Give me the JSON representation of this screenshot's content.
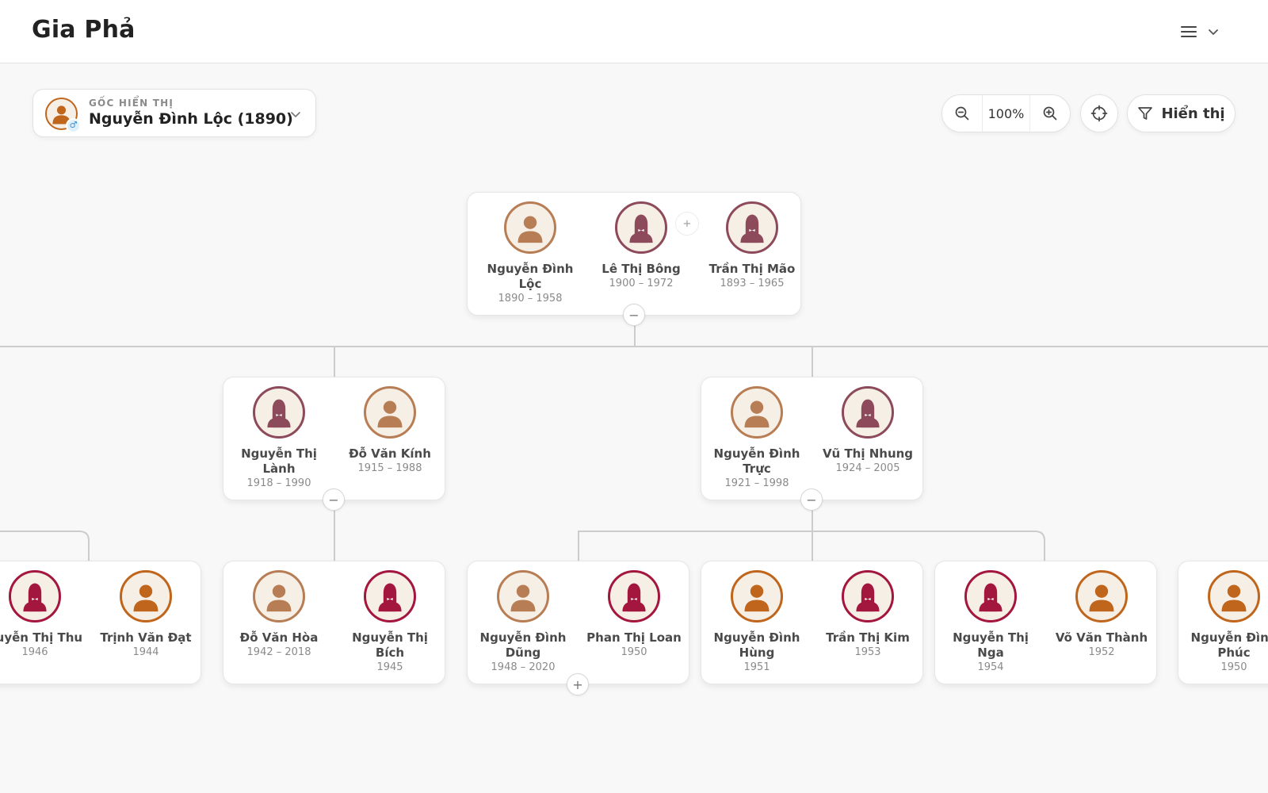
{
  "app": {
    "title": "Gia Phả"
  },
  "header": {
    "menu_icon": "hamburger-icon",
    "menu_caret": "chevron-down-icon"
  },
  "root_picker": {
    "label": "GỐC HIỂN THỊ",
    "value": "Nguyễn Đình Lộc (1890)",
    "gender_symbol": "♂"
  },
  "toolbar": {
    "zoom_value": "100%",
    "display_label": "Hiển thị"
  },
  "colors": {
    "male_deep": "#c0651c",
    "male_light": "#b77d55",
    "female_deep": "#a3163e",
    "female_light": "#8d4a5b",
    "avatar_bg": "#f6efe5",
    "line": "#cccccc"
  },
  "gen1": {
    "people": [
      {
        "name": "Nguyễn Đình Lộc",
        "dates": "1890 – 1958",
        "gender": "male",
        "style": "light"
      },
      {
        "name": "Lê Thị Bông",
        "dates": "1900 – 1972",
        "gender": "female",
        "style": "light"
      },
      {
        "name": "Trần Thị Mão",
        "dates": "1893 – 1965",
        "gender": "female",
        "style": "light"
      }
    ],
    "add_spouse": "+",
    "collapse": "−"
  },
  "gen2": {
    "left": {
      "people": [
        {
          "name": "Nguyễn Thị Lành",
          "dates": "1918 – 1990",
          "gender": "female",
          "style": "light"
        },
        {
          "name": "Đỗ Văn Kính",
          "dates": "1915 – 1988",
          "gender": "male",
          "style": "light"
        }
      ],
      "collapse": "−"
    },
    "right": {
      "people": [
        {
          "name": "Nguyễn Đình Trực",
          "dates": "1921 – 1998",
          "gender": "male",
          "style": "light"
        },
        {
          "name": "Vũ Thị Nhung",
          "dates": "1924 – 2005",
          "gender": "female",
          "style": "light"
        }
      ],
      "collapse": "−"
    }
  },
  "gen3": {
    "card1": {
      "people": [
        {
          "name": "guyễn Thị Thu",
          "dates": "1946",
          "gender": "female",
          "style": "deep"
        },
        {
          "name": "Trịnh Văn Đạt",
          "dates": "1944",
          "gender": "male",
          "style": "deep"
        }
      ]
    },
    "card2": {
      "people": [
        {
          "name": "Đỗ Văn Hòa",
          "dates": "1942 – 2018",
          "gender": "male",
          "style": "light"
        },
        {
          "name": "Nguyễn Thị Bích",
          "dates": "1945",
          "gender": "female",
          "style": "deep"
        }
      ]
    },
    "card3": {
      "people": [
        {
          "name": "Nguyễn Đình Dũng",
          "dates": "1948 – 2020",
          "gender": "male",
          "style": "light"
        },
        {
          "name": "Phan Thị Loan",
          "dates": "1950",
          "gender": "female",
          "style": "deep"
        }
      ],
      "expand": "+"
    },
    "card4": {
      "people": [
        {
          "name": "Nguyễn Đình Hùng",
          "dates": "1951",
          "gender": "male",
          "style": "deep"
        },
        {
          "name": "Trần Thị Kim",
          "dates": "1953",
          "gender": "female",
          "style": "deep"
        }
      ]
    },
    "card5": {
      "people": [
        {
          "name": "Nguyễn Thị Nga",
          "dates": "1954",
          "gender": "female",
          "style": "deep"
        },
        {
          "name": "Võ Văn Thành",
          "dates": "1952",
          "gender": "male",
          "style": "deep"
        }
      ]
    },
    "card6": {
      "people": [
        {
          "name": "Nguyễn Đình Phúc",
          "dates": "1950",
          "gender": "male",
          "style": "deep"
        }
      ]
    }
  }
}
